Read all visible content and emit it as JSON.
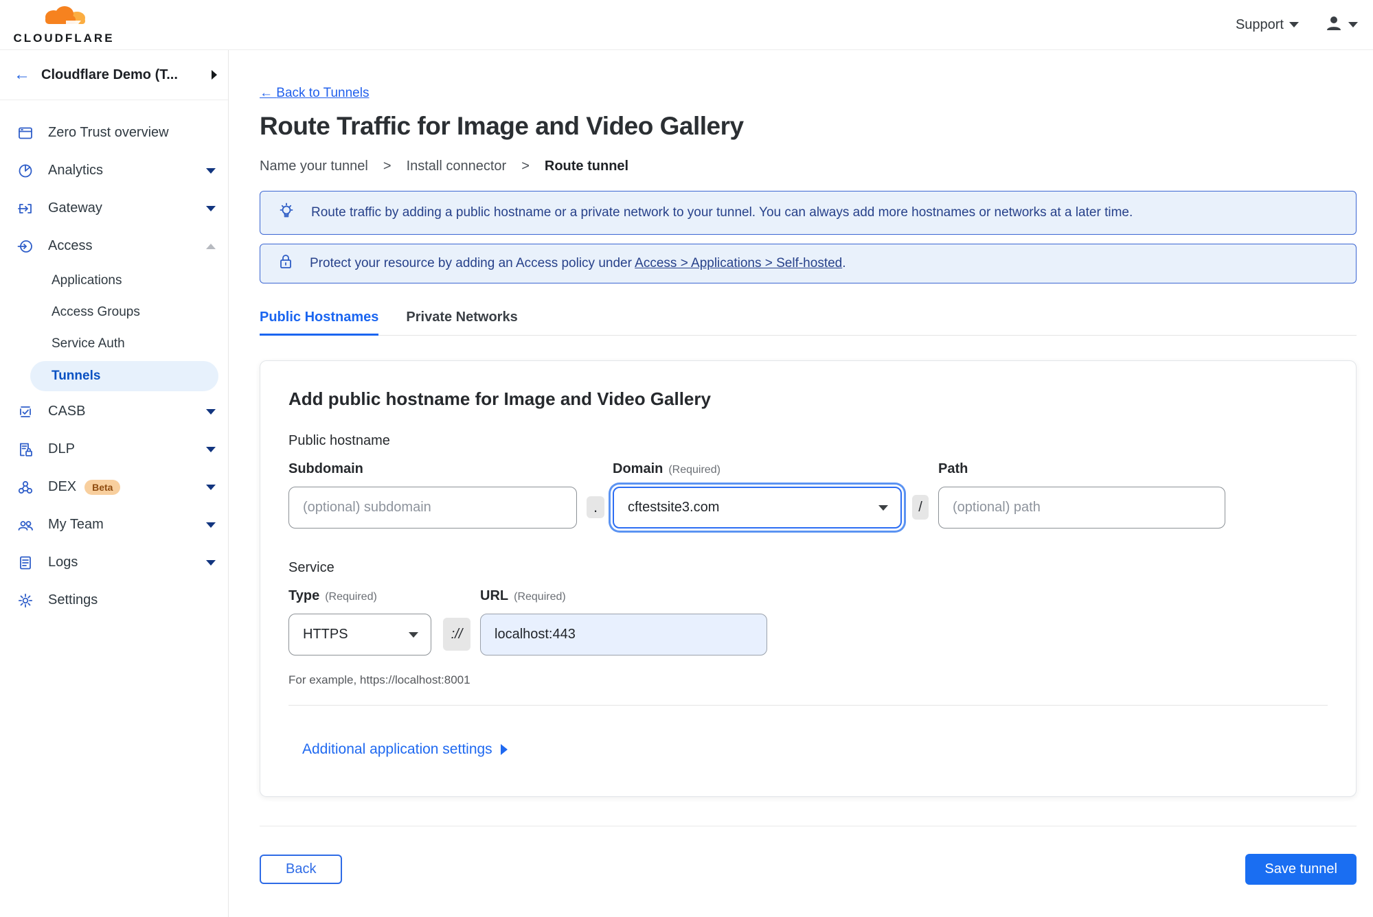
{
  "topbar": {
    "brand": "CLOUDFLARE",
    "support_label": "Support"
  },
  "sidebar": {
    "account_name": "Cloudflare Demo (T...",
    "items": [
      {
        "label": "Zero Trust overview"
      },
      {
        "label": "Analytics"
      },
      {
        "label": "Gateway"
      },
      {
        "label": "Access",
        "children": [
          "Applications",
          "Access Groups",
          "Service Auth",
          "Tunnels"
        ],
        "active_child": "Tunnels"
      },
      {
        "label": "CASB"
      },
      {
        "label": "DLP"
      },
      {
        "label": "DEX",
        "badge": "Beta"
      },
      {
        "label": "My Team"
      },
      {
        "label": "Logs"
      },
      {
        "label": "Settings"
      }
    ]
  },
  "main": {
    "back_arrow": "←",
    "back_link": "Back to Tunnels",
    "title": "Route Traffic for Image and Video Gallery",
    "step_separator": ">",
    "steps": [
      {
        "label": "Name your tunnel"
      },
      {
        "label": "Install connector"
      },
      {
        "label": "Route tunnel"
      }
    ],
    "banners": [
      {
        "text": "Route traffic by adding a public hostname or a private network to your tunnel. You can always add more hostnames or networks at a later time."
      },
      {
        "text_before": "Protect your resource by adding an Access policy under",
        "link": "Access > Applications > Self-hosted",
        "text_after": "."
      }
    ],
    "tabs": [
      {
        "label": "Public Hostnames"
      },
      {
        "label": "Private Networks"
      }
    ],
    "form": {
      "heading": "Add public hostname for Image and Video Gallery",
      "public_hostname_label": "Public hostname",
      "subdomain_label": "Subdomain",
      "subdomain_placeholder": "(optional) subdomain",
      "dot_separator": ".",
      "domain_label": "Domain",
      "required_note": "(Required)",
      "domain_value": "cftestsite3.com",
      "slash_separator": "/",
      "path_label": "Path",
      "path_placeholder": "(optional) path",
      "service_label": "Service",
      "type_label": "Type",
      "type_value": "HTTPS",
      "url_label": "URL",
      "scheme_separator": "://",
      "url_value": "localhost:443",
      "example_text": "For example, https://localhost:8001",
      "additional_settings_label": "Additional application settings"
    },
    "footer": {
      "back_label": "Back",
      "save_label": "Save tunnel"
    }
  },
  "colors": {
    "accent_blue": "#1a6ef2",
    "link_blue": "#2160ec",
    "banner_bg": "#e9f1fb",
    "banner_border": "#3a65d2",
    "banner_text": "#27418a",
    "active_pill_bg": "#e7f1fc",
    "beta_badge_bg": "#f8cf9e",
    "logo_orange": "#f6821f",
    "logo_orange_light": "#fbad41",
    "url_autofill_bg": "#e8f0fe"
  }
}
